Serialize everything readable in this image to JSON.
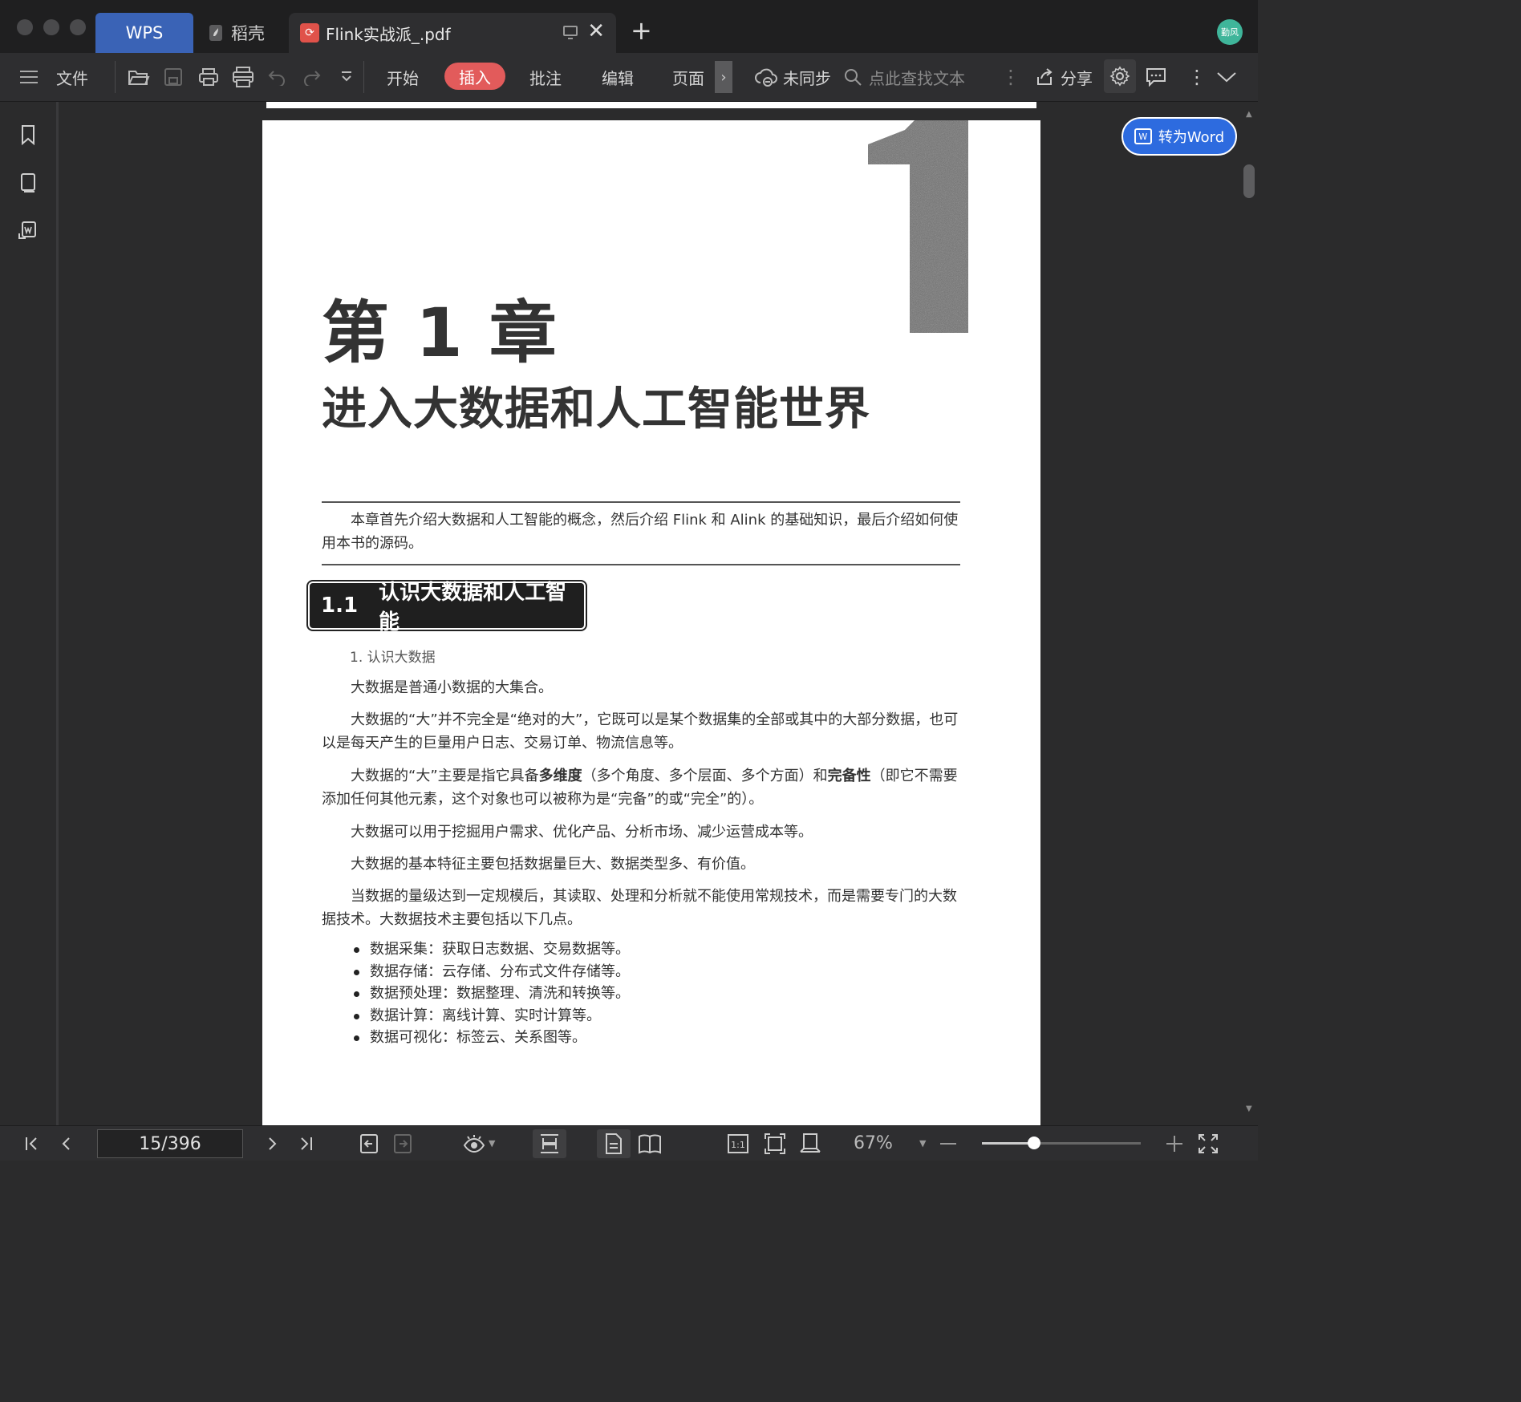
{
  "titlebar": {
    "tabs": [
      {
        "label": "WPS"
      },
      {
        "label": "稻壳"
      },
      {
        "label": "Flink实战派_.pdf"
      }
    ],
    "new_tab": "+",
    "avatar_text": "勤风",
    "brand_color": "#3a63b6"
  },
  "toolbar": {
    "file": "文件",
    "menus": [
      "开始",
      "插入",
      "批注",
      "编辑",
      "页面"
    ],
    "active_menu": "插入",
    "active_color": "#e25b5b",
    "sync": "未同步",
    "search_placeholder": "点此查找文本",
    "share": "分享"
  },
  "convert_button": {
    "label": "转为Word",
    "color": "#2d6bdf"
  },
  "document": {
    "chapter_number": "1",
    "chapter_title": "第 1 章",
    "chapter_subtitle": "进入大数据和人工智能世界",
    "abstract": "本章首先介绍大数据和人工智能的概念，然后介绍 Flink 和 Alink 的基础知识，最后介绍如何使用本书的源码。",
    "section_number": "1.1",
    "section_title": "认识大数据和人工智能",
    "subsection": "1. 认识大数据",
    "p1": "大数据是普通小数据的大集合。",
    "p2": "大数据的“大”并不完全是“绝对的大”，它既可以是某个数据集的全部或其中的大部分数据，也可以是每天产生的巨量用户日志、交易订单、物流信息等。",
    "p3_a": "大数据的“大”主要是指它具备",
    "p3_b1": "多维度",
    "p3_c": "（多个角度、多个层面、多个方面）和",
    "p3_b2": "完备性",
    "p3_d": "（即它不需要添加任何其他元素，这个对象也可以被称为是“完备”的或“完全”的）。",
    "p4": "大数据可以用于挖掘用户需求、优化产品、分析市场、减少运营成本等。",
    "p5": "大数据的基本特征主要包括数据量巨大、数据类型多、有价值。",
    "p6": "当数据的量级达到一定规模后，其读取、处理和分析就不能使用常规技术，而是需要专门的大数据技术。大数据技术主要包括以下几点。",
    "bullets": [
      "数据采集：获取日志数据、交易数据等。",
      "数据存储：云存储、分布式文件存储等。",
      "数据预处理：数据整理、清洗和转换等。",
      "数据计算：离线计算、实时计算等。",
      "数据可视化：标签云、关系图等。"
    ]
  },
  "statusbar": {
    "page_indicator": "15/396",
    "zoom": "67%",
    "zoom_level": 0.33
  }
}
